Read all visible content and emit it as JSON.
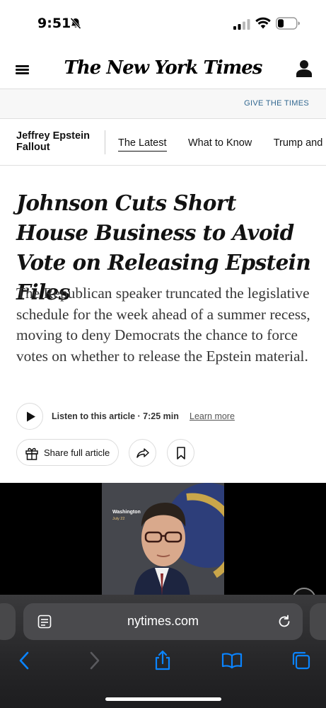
{
  "status_bar": {
    "time": "9:51",
    "icons": [
      "bell-slash-icon",
      "cellular-signal-icon",
      "wifi-icon",
      "battery-icon"
    ]
  },
  "masthead": {
    "logo": "The New York Times",
    "icons": [
      "menu-icon",
      "account-icon"
    ]
  },
  "promo": {
    "link": "GIVE THE TIMES"
  },
  "story_nav": {
    "title": "Jeffrey Epstein Fallout",
    "tabs": [
      {
        "label": "The Latest",
        "active": true
      },
      {
        "label": "What to Know",
        "active": false
      },
      {
        "label": "Trump and E",
        "active": false
      }
    ]
  },
  "article": {
    "headline": "Johnson Cuts Short House Business to Avoid Vote on Releasing Epstein Files",
    "summary": "The Republican speaker truncated the legislative schedule for the week ahead of a summer recess, moving to deny Democrats the chance to force votes on whether to release the Epstein material.",
    "listen_label": "Listen to this article · 7:25 min",
    "learn_more": "Learn more",
    "share_label": "Share full article"
  },
  "media": {
    "location": "Washington",
    "date": "July 22"
  },
  "safari": {
    "url": "nytimes.com",
    "icons": [
      "reader-icon",
      "reload-icon",
      "back-icon",
      "forward-icon",
      "share-icon",
      "bookmarks-icon",
      "tabs-icon"
    ]
  },
  "colors": {
    "link_blue": "#326891",
    "safari_blue": "#0a84ff",
    "toolbar_gray": "#2c2c2e"
  }
}
